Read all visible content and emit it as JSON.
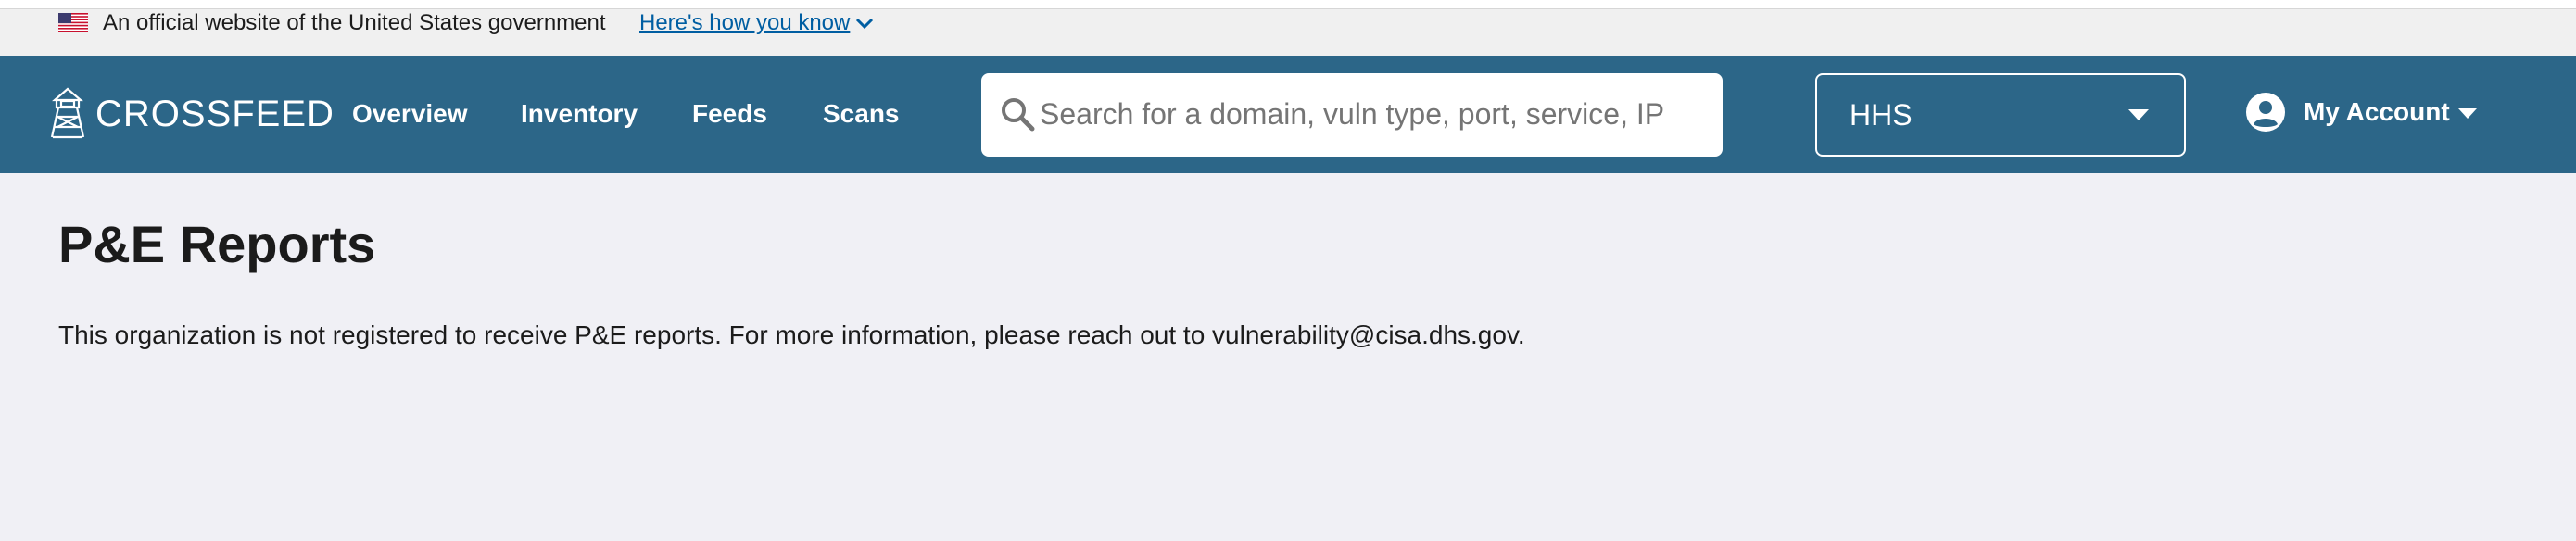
{
  "gov_banner": {
    "text": "An official website of the United States government",
    "link_label": "Here's how you know"
  },
  "header": {
    "logo_text": "CROSSFEED",
    "nav": [
      {
        "label": "Overview"
      },
      {
        "label": "Inventory"
      },
      {
        "label": "Feeds"
      },
      {
        "label": "Scans"
      }
    ],
    "search": {
      "placeholder": "Search for a domain, vuln type, port, service, IP",
      "value": ""
    },
    "org_select": {
      "value": "HHS"
    },
    "account": {
      "label": "My Account"
    }
  },
  "main": {
    "title": "P&E Reports",
    "message": "This organization is not registered to receive P&E reports. For more information, please reach out to vulnerability@cisa.dhs.gov."
  },
  "colors": {
    "nav_background": "#2c6688",
    "page_background": "#f0f0f5",
    "banner_background": "#f0f0f0",
    "link": "#005ea2"
  }
}
